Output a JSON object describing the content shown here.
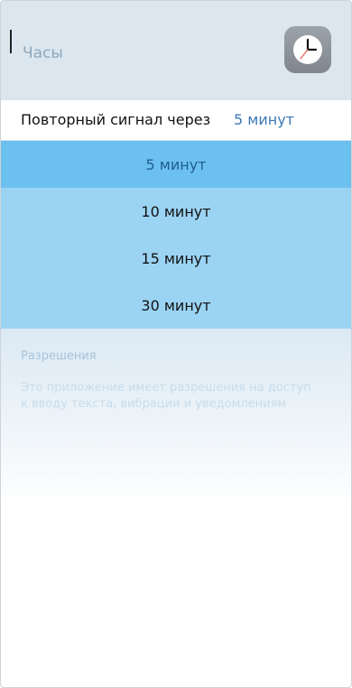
{
  "header": {
    "title": "Часы",
    "icon": "clock-icon"
  },
  "snooze": {
    "label": "Повторный сигнал через",
    "value": "5 минут"
  },
  "options": [
    {
      "label": "5 минут",
      "selected": true
    },
    {
      "label": "10 минут",
      "selected": false
    },
    {
      "label": "15 минут",
      "selected": false
    },
    {
      "label": "30 минут",
      "selected": false
    }
  ],
  "permissions": {
    "title": "Разрешения",
    "text": "Это приложение имеет разрешения на доступ к вводу текста, вибрации и уведомлениям"
  },
  "colors": {
    "accent": "#3b78b6",
    "selected_bg": "#6cc0ef",
    "list_bg": "#9bd3f3"
  }
}
